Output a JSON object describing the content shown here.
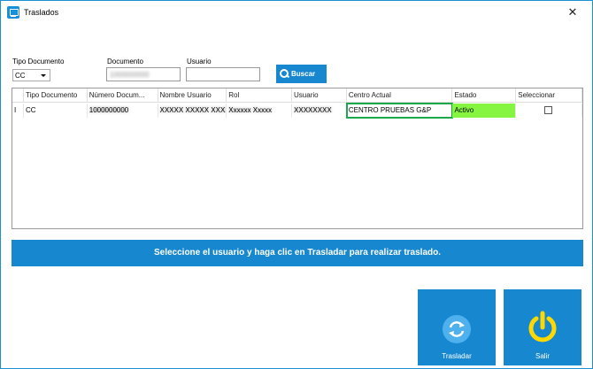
{
  "window": {
    "title": "Traslados",
    "close": "✕"
  },
  "filters": {
    "tipo_documento_label": "Tipo Documento",
    "tipo_documento_value": "CC",
    "documento_label": "Documento",
    "documento_value": "1000000000",
    "usuario_label": "Usuario",
    "usuario_value": ""
  },
  "buscar_label": "Buscar",
  "grid": {
    "columns": [
      "Tipo Documento",
      "Número Docum...",
      "Nombre Usuario",
      "Rol",
      "Usuario",
      "Centro Actual",
      "Estado",
      "Seleccionar"
    ],
    "row": {
      "marker": "I",
      "tipo_documento": "CC",
      "numero_documento": "1000000000",
      "nombre_usuario": "XXXXX XXXXX XXXX",
      "rol": "Xxxxxx Xxxxx",
      "usuario": "XXXXXXXX",
      "centro_actual": "CENTRO PRUEBAS G&P",
      "estado": "Activo"
    }
  },
  "instruction_banner": "Seleccione el usuario y haga clic en Trasladar para realizar traslado.",
  "actions": {
    "trasladar_label": "Trasladar",
    "salir_label": "Salir"
  },
  "colors": {
    "accent": "#1787cf",
    "active_status": "#86f542",
    "highlight": "#1aa84a",
    "power": "#ffd800"
  }
}
